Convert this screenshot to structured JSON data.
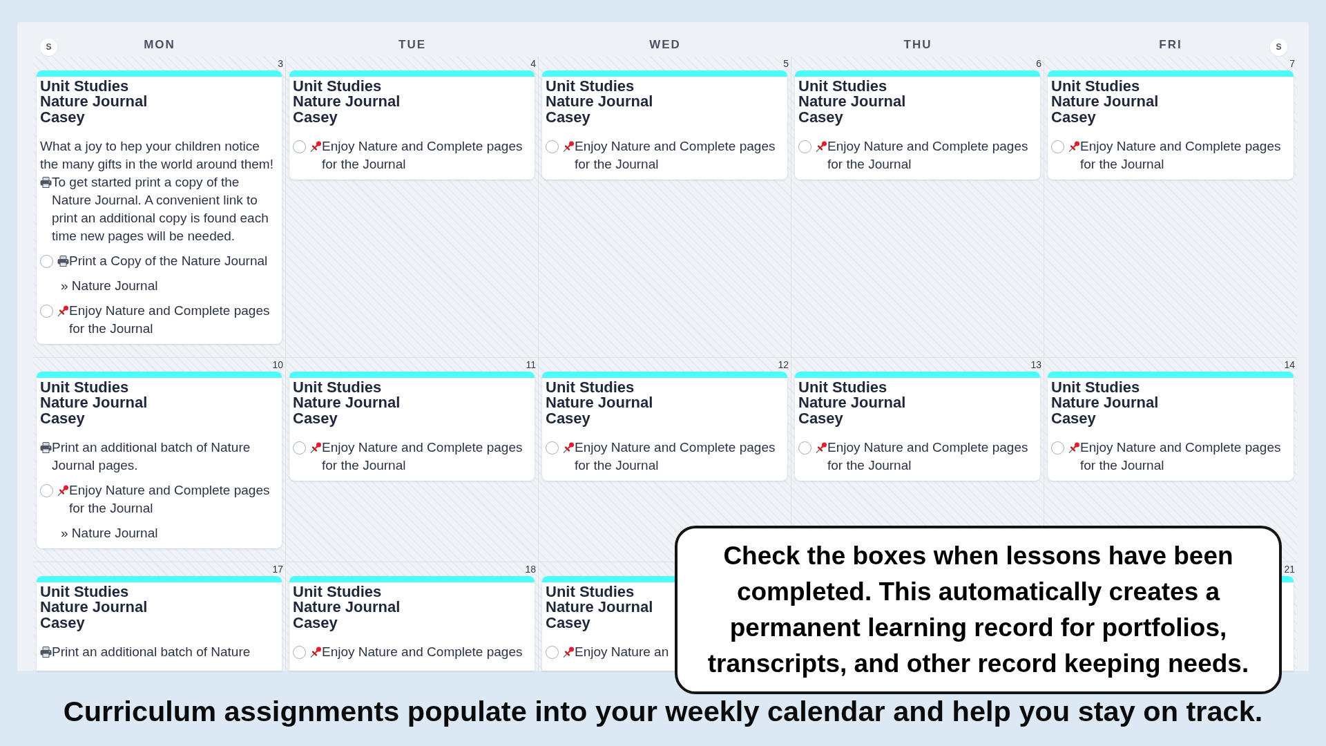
{
  "calendar": {
    "weekend_toggles": [
      "S",
      "S"
    ],
    "weekdays": [
      "MON",
      "TUE",
      "WED",
      "THU",
      "FRI"
    ],
    "weeks": [
      {
        "days": {
          "mon": {
            "date": "3",
            "events": [
              {
                "color": "#4afcfc",
                "category": "Unit Studies",
                "course": "Nature Journal",
                "student": "Casey",
                "items": [
                  {
                    "kind": "note",
                    "lead": "What a joy to hep your children notice the many gifts in the world around them!",
                    "text": "To get started print a copy of the Nature Journal. A convenient link to print an additional copy is found each time new pages will be needed."
                  },
                  {
                    "kind": "printtask",
                    "text": "Print a Copy of the Nature Journal",
                    "checked": false
                  },
                  {
                    "kind": "link",
                    "text": "» Nature Journal"
                  },
                  {
                    "kind": "pintask",
                    "text": "Enjoy Nature and Complete pages for the Journal",
                    "checked": false
                  }
                ]
              }
            ]
          },
          "tue": {
            "date": "4",
            "events": [
              {
                "color": "#4afcfc",
                "category": "Unit Studies",
                "course": "Nature Journal",
                "student": "Casey",
                "items": [
                  {
                    "kind": "pintask",
                    "text": "Enjoy Nature and Complete pages for the Journal",
                    "checked": false
                  }
                ]
              }
            ]
          },
          "wed": {
            "date": "5",
            "events": [
              {
                "color": "#4afcfc",
                "category": "Unit Studies",
                "course": "Nature Journal",
                "student": "Casey",
                "items": [
                  {
                    "kind": "pintask",
                    "text": "Enjoy Nature and Complete pages for the Journal",
                    "checked": false
                  }
                ]
              }
            ]
          },
          "thu": {
            "date": "6",
            "events": [
              {
                "color": "#4afcfc",
                "category": "Unit Studies",
                "course": "Nature Journal",
                "student": "Casey",
                "items": [
                  {
                    "kind": "pintask",
                    "text": "Enjoy Nature and Complete pages for the Journal",
                    "checked": false
                  }
                ]
              }
            ]
          },
          "fri": {
            "date": "7",
            "events": [
              {
                "color": "#4afcfc",
                "category": "Unit Studies",
                "course": "Nature Journal",
                "student": "Casey",
                "items": [
                  {
                    "kind": "pintask",
                    "text": "Enjoy Nature and Complete pages for the Journal",
                    "checked": false
                  }
                ]
              }
            ]
          }
        }
      },
      {
        "days": {
          "mon": {
            "date": "10",
            "events": [
              {
                "color": "#4afcfc",
                "category": "Unit Studies",
                "course": "Nature Journal",
                "student": "Casey",
                "items": [
                  {
                    "kind": "note",
                    "text": "Print an additional batch of Nature Journal pages."
                  },
                  {
                    "kind": "pintask",
                    "text": "Enjoy Nature and Complete pages for the Journal",
                    "checked": false
                  },
                  {
                    "kind": "link",
                    "text": "» Nature Journal"
                  }
                ]
              }
            ]
          },
          "tue": {
            "date": "11",
            "events": [
              {
                "color": "#4afcfc",
                "category": "Unit Studies",
                "course": "Nature Journal",
                "student": "Casey",
                "items": [
                  {
                    "kind": "pintask",
                    "text": "Enjoy Nature and Complete pages for the Journal",
                    "checked": false
                  }
                ]
              }
            ]
          },
          "wed": {
            "date": "12",
            "events": [
              {
                "color": "#4afcfc",
                "category": "Unit Studies",
                "course": "Nature Journal",
                "student": "Casey",
                "items": [
                  {
                    "kind": "pintask",
                    "text": "Enjoy Nature and Complete pages for the Journal",
                    "checked": false
                  }
                ]
              }
            ]
          },
          "thu": {
            "date": "13",
            "events": [
              {
                "color": "#4afcfc",
                "category": "Unit Studies",
                "course": "Nature Journal",
                "student": "Casey",
                "items": [
                  {
                    "kind": "pintask",
                    "text": "Enjoy Nature and Complete pages for the Journal",
                    "checked": false
                  }
                ]
              }
            ]
          },
          "fri": {
            "date": "14",
            "events": [
              {
                "color": "#4afcfc",
                "category": "Unit Studies",
                "course": "Nature Journal",
                "student": "Casey",
                "items": [
                  {
                    "kind": "pintask",
                    "text": "Enjoy Nature and Complete pages for the Journal",
                    "checked": false
                  }
                ]
              }
            ]
          }
        }
      },
      {
        "days": {
          "mon": {
            "date": "17",
            "events": [
              {
                "color": "#4afcfc",
                "category": "Unit Studies",
                "course": "Nature Journal",
                "student": "Casey",
                "items": [
                  {
                    "kind": "note",
                    "text": "Print an additional batch of Nature"
                  }
                ]
              }
            ]
          },
          "tue": {
            "date": "18",
            "events": [
              {
                "color": "#4afcfc",
                "category": "Unit Studies",
                "course": "Nature Journal",
                "student": "Casey",
                "items": [
                  {
                    "kind": "pintask",
                    "text": "Enjoy Nature and Complete pages",
                    "checked": false
                  }
                ]
              }
            ]
          },
          "wed": {
            "events": [
              {
                "color": "#4afcfc",
                "category": "Unit Studies",
                "course": "Nature Journal",
                "student": "Casey",
                "items": [
                  {
                    "kind": "pintask",
                    "text": "Enjoy Nature an",
                    "checked": false
                  }
                ]
              }
            ]
          },
          "fri": {
            "date": "21",
            "events": [
              {
                "color": "#4afcfc"
              }
            ]
          }
        }
      }
    ]
  },
  "callout": {
    "text": "Check the boxes when lessons have been completed. This automatically creates a permanent learning record for portfolios, transcripts, and other record keeping needs."
  },
  "caption": {
    "text": "Curriculum assignments populate into your weekly calendar and help you stay on track."
  }
}
